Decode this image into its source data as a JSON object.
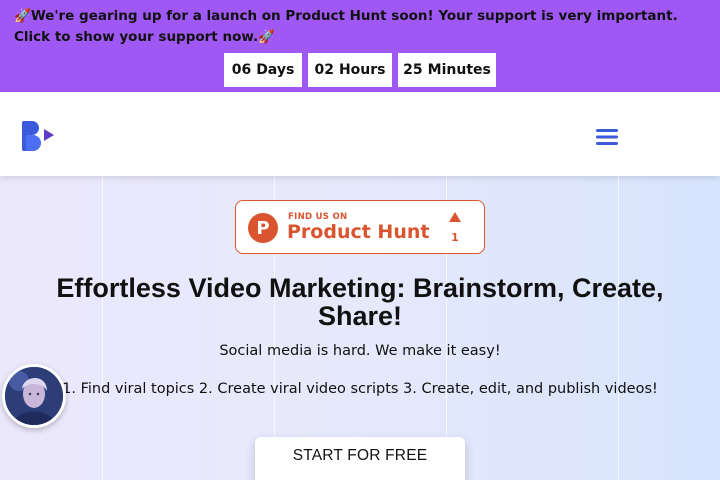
{
  "banner": {
    "message": "We're gearing up for a launch on Product Hunt soon! Your support is very important. Click to show your support now.",
    "icon": "rocket-icon",
    "countdown": [
      {
        "value": "06",
        "unit": "Days"
      },
      {
        "value": "02",
        "unit": "Hours"
      },
      {
        "value": "25",
        "unit": "Minutes"
      }
    ],
    "background_color": "#a058f5"
  },
  "navbar": {
    "logo_icon": "brand-logo-icon",
    "menu_icon": "hamburger-menu-icon",
    "accent_color": "#3b5bdb"
  },
  "hero": {
    "product_hunt": {
      "small": "FIND US ON",
      "big": "Product Hunt",
      "logo_letter": "P",
      "upvotes": "1",
      "color": "#da552f"
    },
    "headline": "Effortless Video Marketing: Brainstorm, Create, Share!",
    "subtitle": "Social media is hard. We make it easy!",
    "steps": "1. Find viral topics 2. Create viral video scripts 3. Create, edit, and publish videos!",
    "cta_label": "START FOR FREE"
  }
}
